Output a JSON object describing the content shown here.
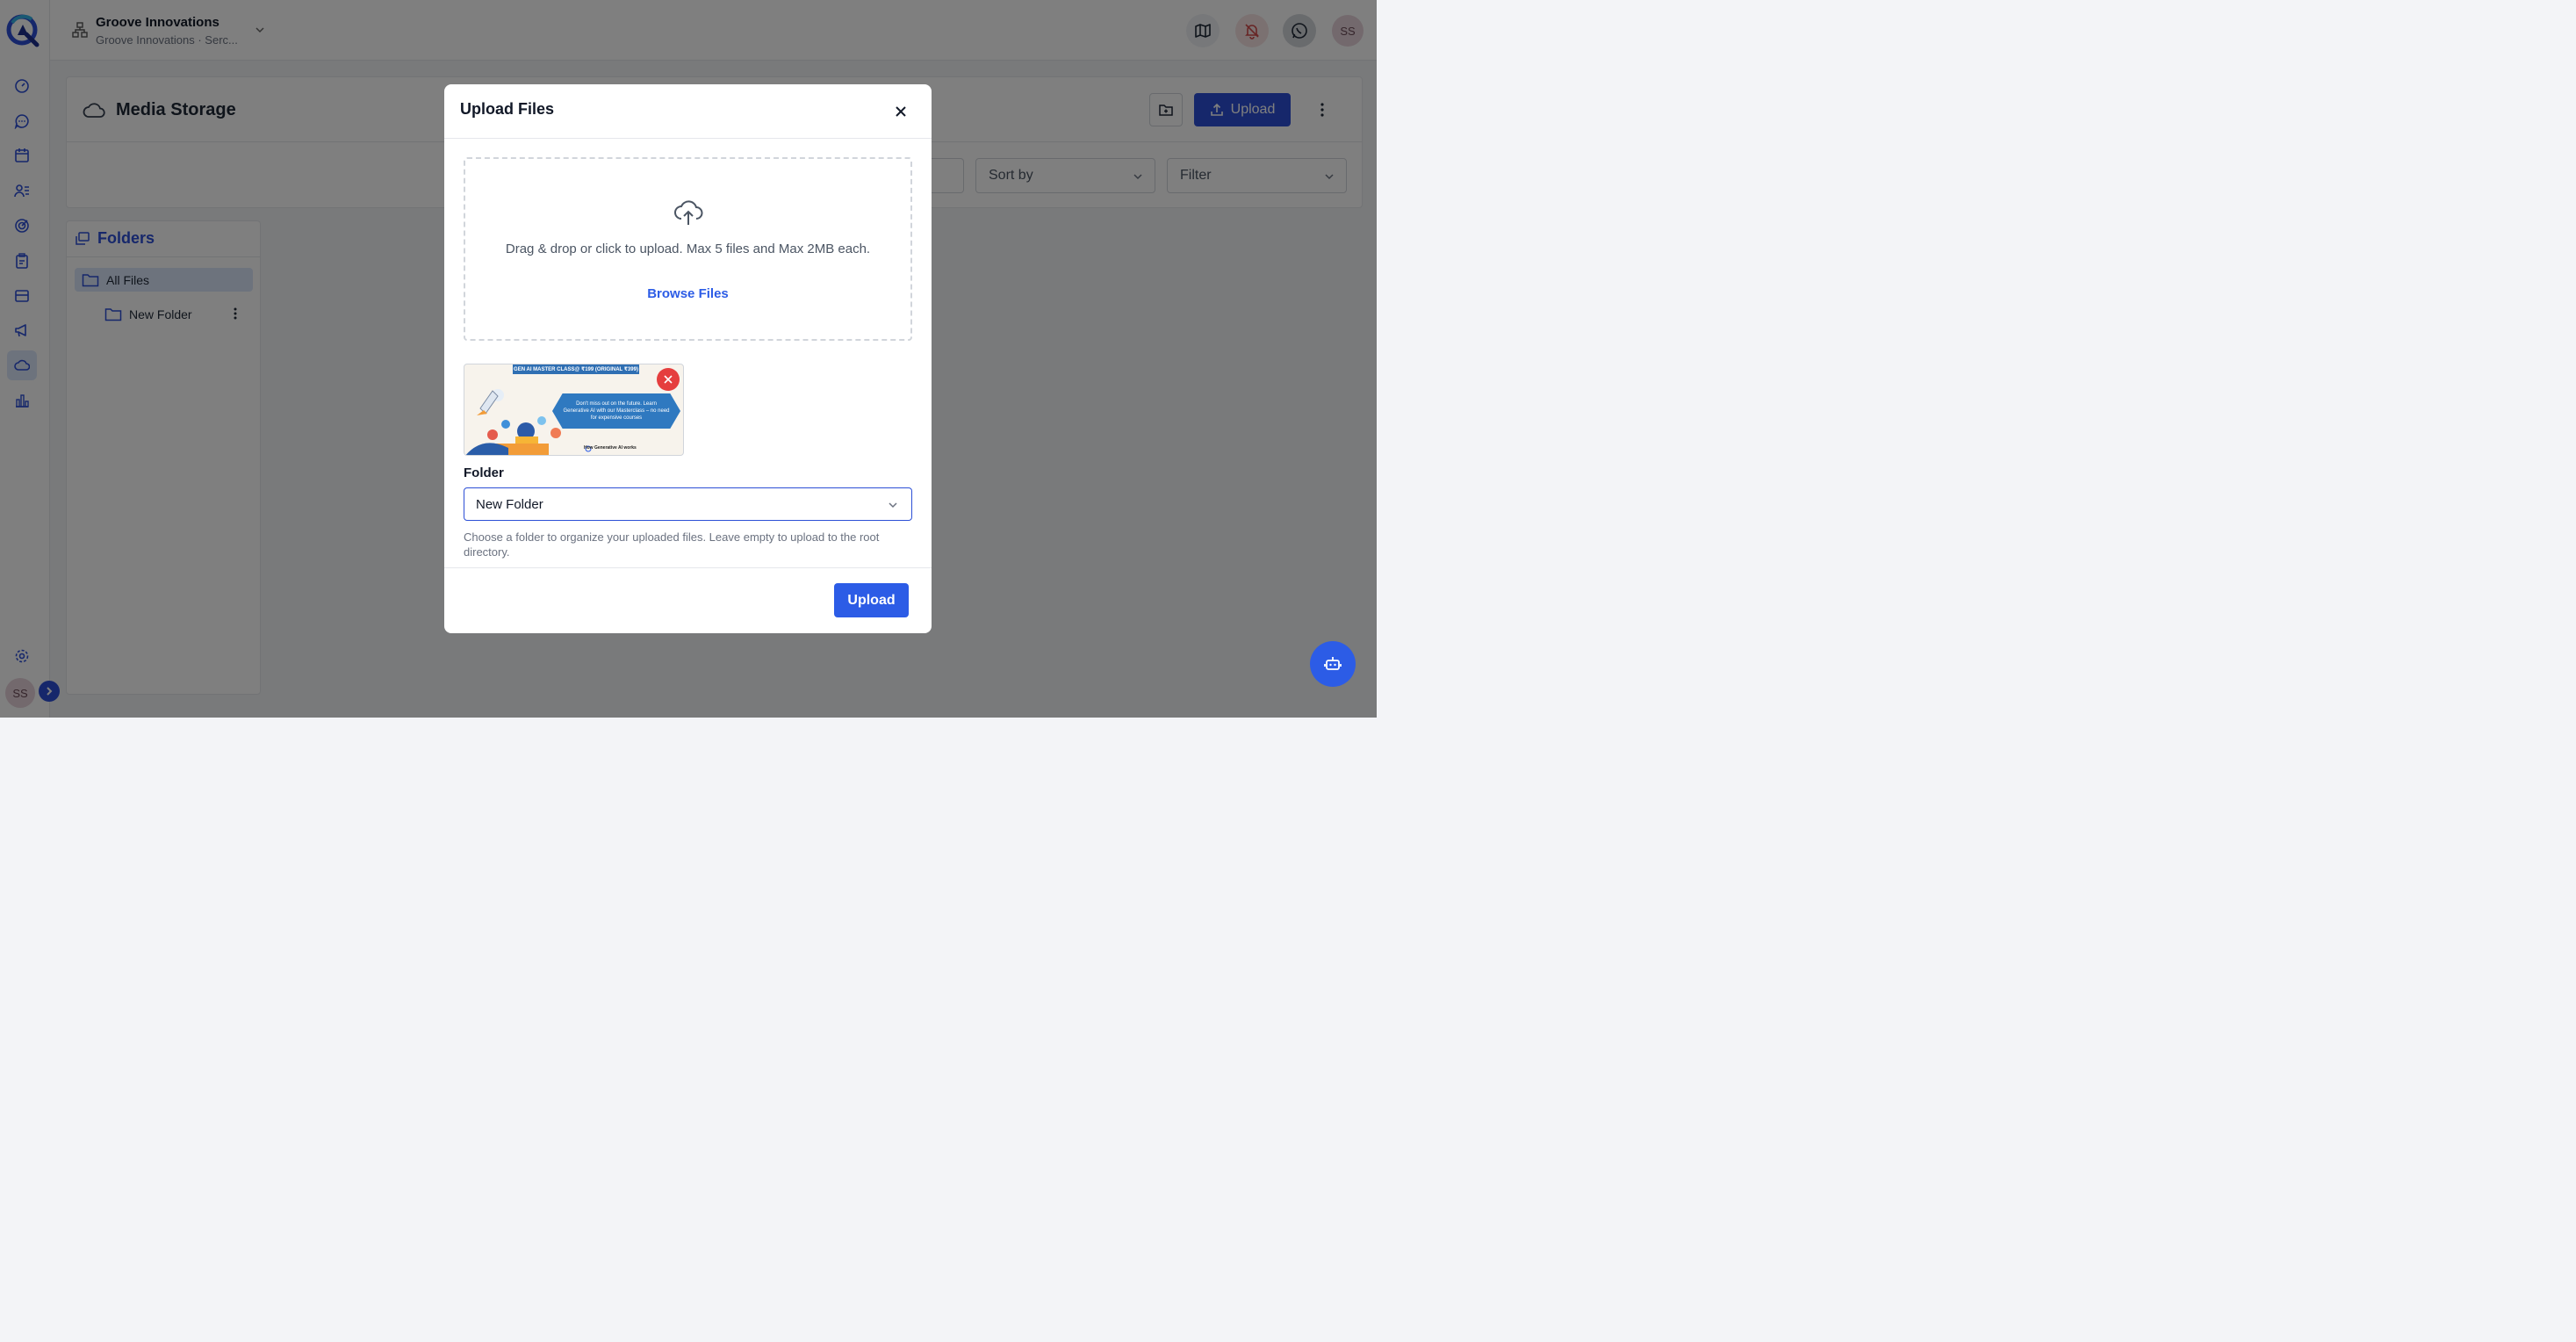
{
  "topbar": {
    "org_name": "Groove Innovations",
    "org_sub": "Groove Innovations · Serc...",
    "user_initials": "SS"
  },
  "sidebar": {
    "items": [
      "dashboard-icon",
      "chat-icon",
      "calendar-icon",
      "contacts-icon",
      "target-icon",
      "clipboard-icon",
      "inbox-icon",
      "megaphone-icon",
      "cloud-icon",
      "chart-icon"
    ],
    "active": "cloud-icon",
    "user_initials": "SS"
  },
  "page": {
    "title": "Media Storage",
    "upload_label": "Upload",
    "sort_label": "Sort by",
    "filter_label": "Filter"
  },
  "folders": {
    "title": "Folders",
    "all_files": "All Files",
    "items": [
      "New Folder"
    ]
  },
  "modal": {
    "title": "Upload Files",
    "drop_text": "Drag & drop or click to upload. Max 5 files and Max 2MB each.",
    "browse_label": "Browse Files",
    "thumbnail": {
      "banner": "GEN AI MASTER CLASS@ ₹199 (ORIGINAL ₹399)",
      "body": "Don't miss out on the future. Learn Generative AI with our Masterclass – no need for expensive courses",
      "caption": "How Generative AI works"
    },
    "folder_label": "Folder",
    "folder_value": "New Folder",
    "help_text": "Choose a folder to organize your uploaded files. Leave empty to upload to the root directory.",
    "upload_label": "Upload"
  },
  "colors": {
    "primary": "#2c4fd6",
    "accent": "#2c5ce6",
    "danger": "#e53e3e"
  }
}
